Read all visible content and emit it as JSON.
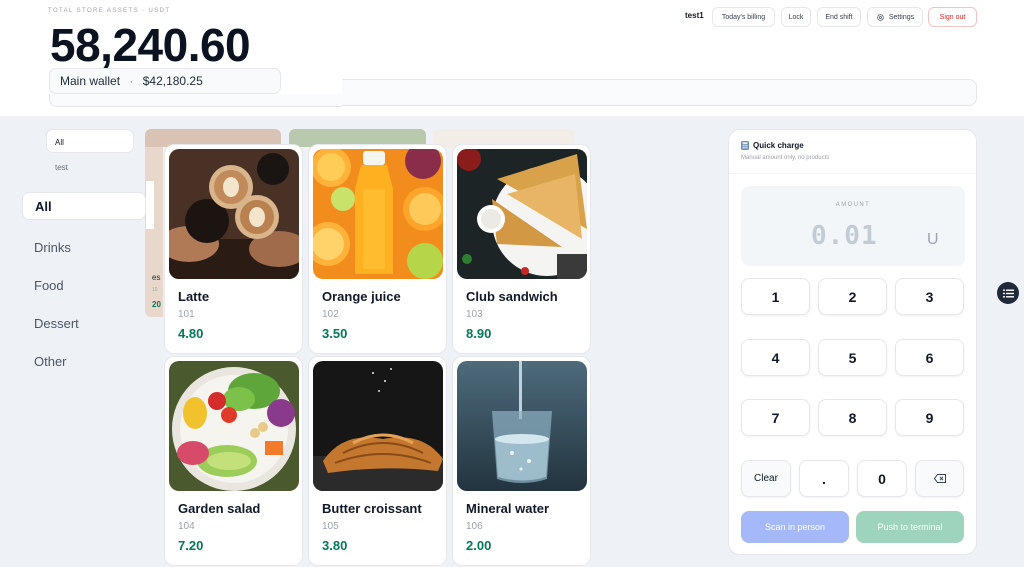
{
  "header": {
    "assets_label": "TOTAL STORE ASSETS · USDT",
    "total": "58,240.60",
    "wallet_name": "Main wallet",
    "wallet_separator": "·",
    "wallet_amount": "$42,180.25",
    "user": "test1",
    "buttons": {
      "billing": "Today's billing",
      "lock": "Lock",
      "end_shift": "End shift",
      "settings": "Settings",
      "sign_out": "Sign out"
    }
  },
  "filters": {
    "all": "All",
    "test": "test"
  },
  "categories": [
    {
      "label": "All",
      "active": true
    },
    {
      "label": "Drinks"
    },
    {
      "label": "Food"
    },
    {
      "label": "Dessert"
    },
    {
      "label": "Other"
    }
  ],
  "ghost": {
    "t1": "es",
    "t2": "10",
    "t3": "20"
  },
  "products": [
    {
      "name": "Latte",
      "code": "101",
      "price": "4.80",
      "icon": "latte-photo"
    },
    {
      "name": "Orange juice",
      "code": "102",
      "price": "3.50",
      "icon": "orange-juice-photo"
    },
    {
      "name": "Club sandwich",
      "code": "103",
      "price": "8.90",
      "icon": "club-sandwich-photo"
    },
    {
      "name": "Garden salad",
      "code": "104",
      "price": "7.20",
      "icon": "garden-salad-photo"
    },
    {
      "name": "Butter croissant",
      "code": "105",
      "price": "3.80",
      "icon": "croissant-photo"
    },
    {
      "name": "Mineral water",
      "code": "106",
      "price": "2.00",
      "icon": "mineral-water-photo"
    }
  ],
  "quick_charge": {
    "title": "Quick charge",
    "subtitle": "Manual amount only, no products",
    "amount_label": "AMOUNT",
    "amount": "0.01",
    "unit": "U",
    "keys": [
      "1",
      "2",
      "3",
      "4",
      "5",
      "6",
      "7",
      "8",
      "9"
    ],
    "clear": "Clear",
    "dot": ".",
    "zero": "0",
    "scan_label": "Scan in person",
    "push_label": "Push to terminal"
  },
  "colors": {
    "price": "#047857",
    "scan_button": "#a5b8fa",
    "push_button": "#9ed3bd",
    "sign_out": "#dc2626"
  }
}
